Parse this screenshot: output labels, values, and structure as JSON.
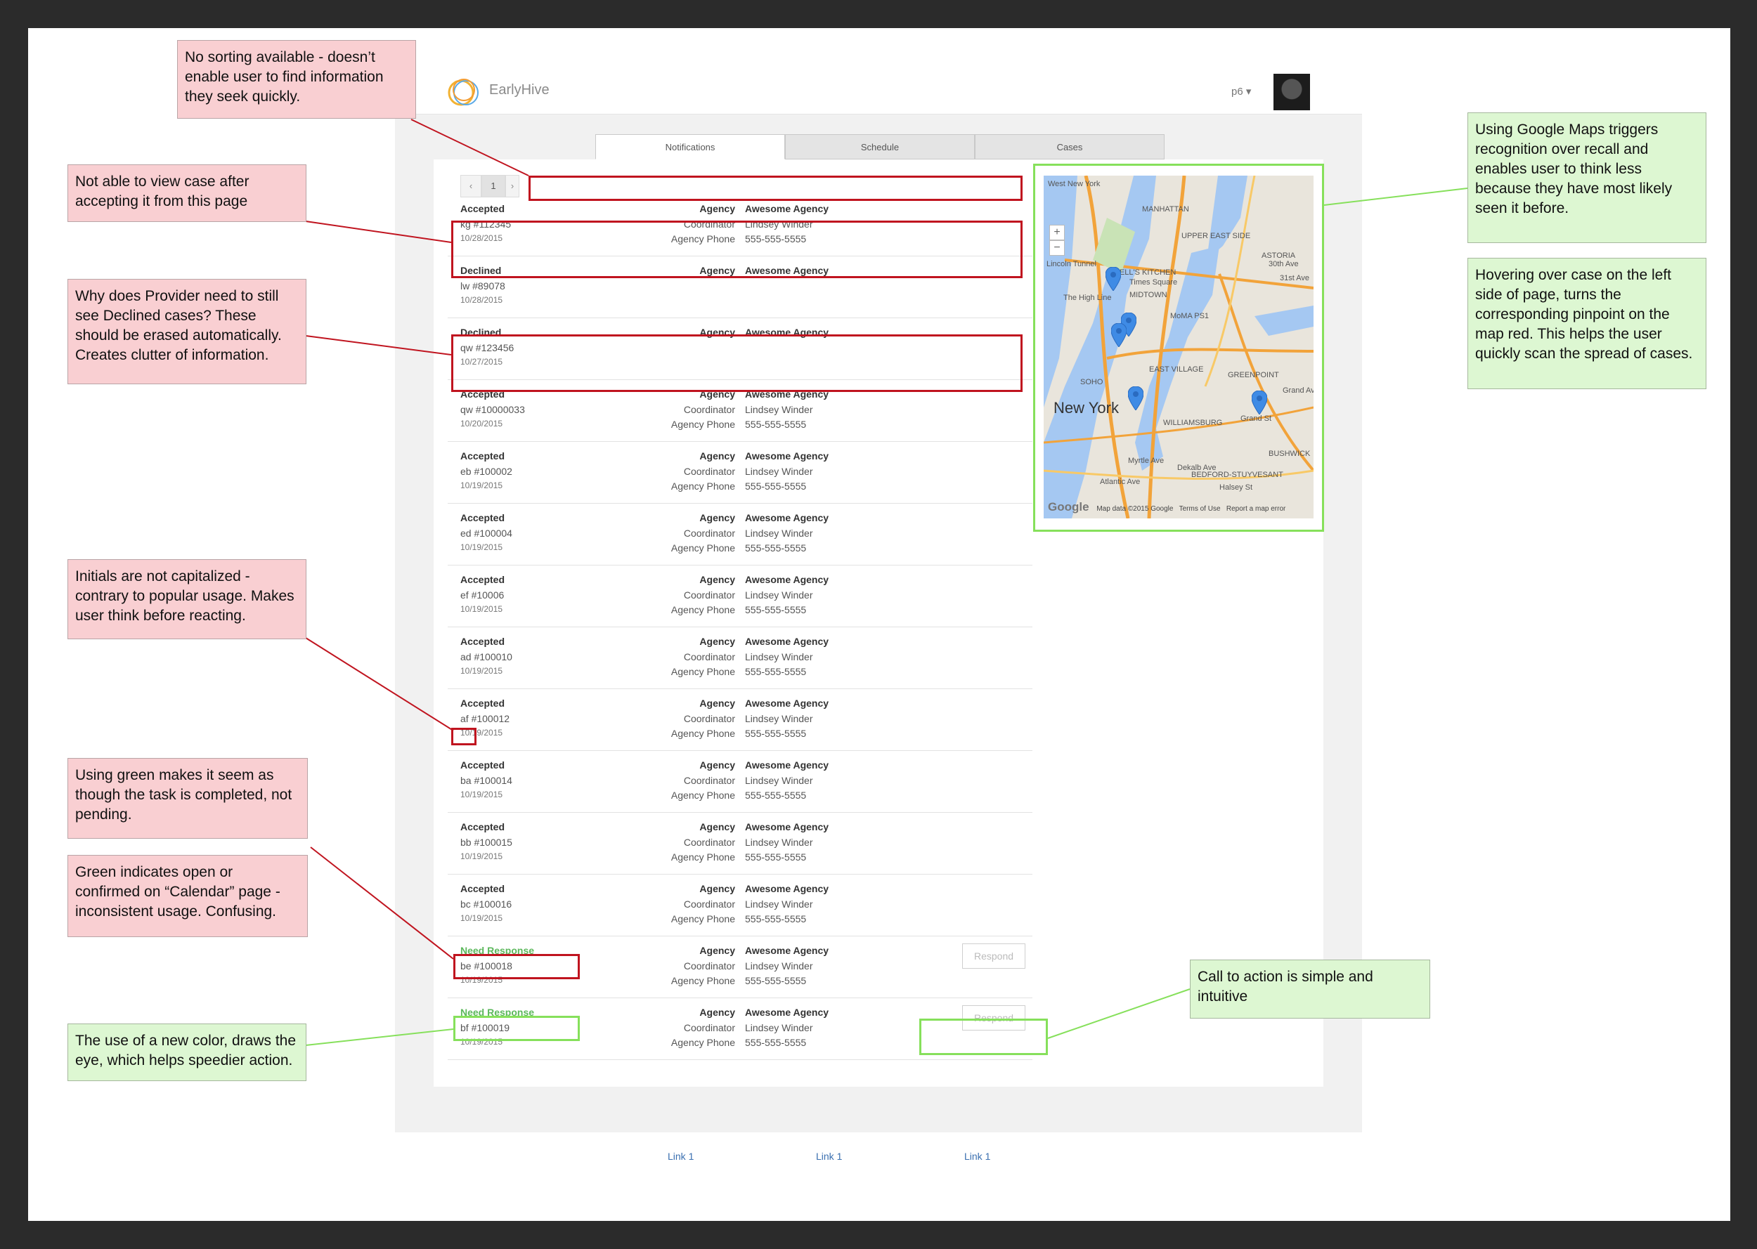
{
  "app": {
    "brand": "EarlyHive",
    "user_menu": "p6 ▾",
    "tabs": [
      "Notifications",
      "Schedule",
      "Cases"
    ],
    "active_tab": "Notifications",
    "pagination": {
      "prev": "‹",
      "page": "1",
      "next": "›"
    },
    "rows": [
      {
        "status": "Accepted",
        "case": "kg #112345",
        "date": "10/28/2015",
        "agency": "Awesome Agency",
        "coordinator": "Lindsey Winder",
        "phone": "555-555-5555"
      },
      {
        "status": "Declined",
        "case": "lw #89078",
        "date": "10/28/2015",
        "agency": "Awesome Agency"
      },
      {
        "status": "Declined",
        "case": "qw #123456",
        "date": "10/27/2015",
        "agency": "Awesome Agency"
      },
      {
        "status": "Accepted",
        "case": "qw #10000033",
        "date": "10/20/2015",
        "agency": "Awesome Agency",
        "coordinator": "Lindsey Winder",
        "phone": "555-555-5555"
      },
      {
        "status": "Accepted",
        "case": "eb #100002",
        "date": "10/19/2015",
        "agency": "Awesome Agency",
        "coordinator": "Lindsey Winder",
        "phone": "555-555-5555"
      },
      {
        "status": "Accepted",
        "case": "ed #100004",
        "date": "10/19/2015",
        "agency": "Awesome Agency",
        "coordinator": "Lindsey Winder",
        "phone": "555-555-5555"
      },
      {
        "status": "Accepted",
        "case": "ef #10006",
        "date": "10/19/2015",
        "agency": "Awesome Agency",
        "coordinator": "Lindsey Winder",
        "phone": "555-555-5555"
      },
      {
        "status": "Accepted",
        "case": "ad #100010",
        "date": "10/19/2015",
        "agency": "Awesome Agency",
        "coordinator": "Lindsey Winder",
        "phone": "555-555-5555"
      },
      {
        "status": "Accepted",
        "case": "af #100012",
        "date": "10/19/2015",
        "agency": "Awesome Agency",
        "coordinator": "Lindsey Winder",
        "phone": "555-555-5555"
      },
      {
        "status": "Accepted",
        "case": "ba #100014",
        "date": "10/19/2015",
        "agency": "Awesome Agency",
        "coordinator": "Lindsey Winder",
        "phone": "555-555-5555"
      },
      {
        "status": "Accepted",
        "case": "bb #100015",
        "date": "10/19/2015",
        "agency": "Awesome Agency",
        "coordinator": "Lindsey Winder",
        "phone": "555-555-5555"
      },
      {
        "status": "Accepted",
        "case": "bc #100016",
        "date": "10/19/2015",
        "agency": "Awesome Agency",
        "coordinator": "Lindsey Winder",
        "phone": "555-555-5555"
      },
      {
        "status": "Need Response",
        "case": "be #100018",
        "date": "10/19/2015",
        "agency": "Awesome Agency",
        "coordinator": "Lindsey Winder",
        "phone": "555-555-5555",
        "action": "Respond"
      },
      {
        "status": "Need Response",
        "case": "bf #100019",
        "date": "10/19/2015",
        "agency": "Awesome Agency",
        "coordinator": "Lindsey Winder",
        "phone": "555-555-5555",
        "action": "Respond"
      }
    ],
    "field_labels": {
      "agency": "Agency",
      "coordinator": "Coordinator",
      "phone": "Agency Phone"
    },
    "map": {
      "city": "New York",
      "labels": [
        "West New York",
        "MANHATTAN",
        "UPPER EAST SIDE",
        "ASTORIA",
        "HELL'S KITCHEN",
        "Times Square",
        "MIDTOWN",
        "The High Line",
        "MoMA PS1",
        "Lincoln Tunnel",
        "EAST VILLAGE",
        "SOHO",
        "GREENPOINT",
        "WILLIAMSBURG",
        "BUSHWICK",
        "BEDFORD-STUYVESANT",
        "Myrtle Ave",
        "Dekalb Ave",
        "Halsey St",
        "Grand St",
        "Grand Ave",
        "Atlantic Ave",
        "31st Ave",
        "30th Ave"
      ],
      "footer": {
        "logo": "Google",
        "data": "Map data ©2015 Google",
        "terms": "Terms of Use",
        "report": "Report a map error"
      }
    },
    "footer_links": [
      "Link 1",
      "Link 1",
      "Link 1"
    ]
  },
  "annotations": {
    "sorting": "No sorting available - doesn’t enable user to find information they seek quickly.",
    "view_case": "Not able to view case after accepting it from this page",
    "declined": "Why does Provider need to still see Declined cases? These should be erased automatically. Creates clutter of information.",
    "initials": "Initials are not capitalized - contrary to popular usage. Makes user think before reacting.",
    "green_pending": "Using green makes it seem as though the task is completed, not pending.",
    "green_calendar": "Green indicates open or confirmed on “Calendar” page - inconsistent usage. Confusing.",
    "new_color": "The use of a new color, draws the eye, which helps speedier action.",
    "google_maps": "Using Google Maps triggers recognition over recall and enables user to think less because they have most likely seen it before.",
    "hover": "Hovering over case on the left side of page, turns the corresponding pinpoint on the map red. This helps the user quickly scan the spread of cases.",
    "cta": "Call to action is simple and intuitive"
  },
  "colors": {
    "negative": "#c0141f",
    "positive": "#86e05b",
    "need_response": "#5cb85c",
    "negative_note": "#f9cfd2",
    "positive_note": "#ddf7d2"
  }
}
